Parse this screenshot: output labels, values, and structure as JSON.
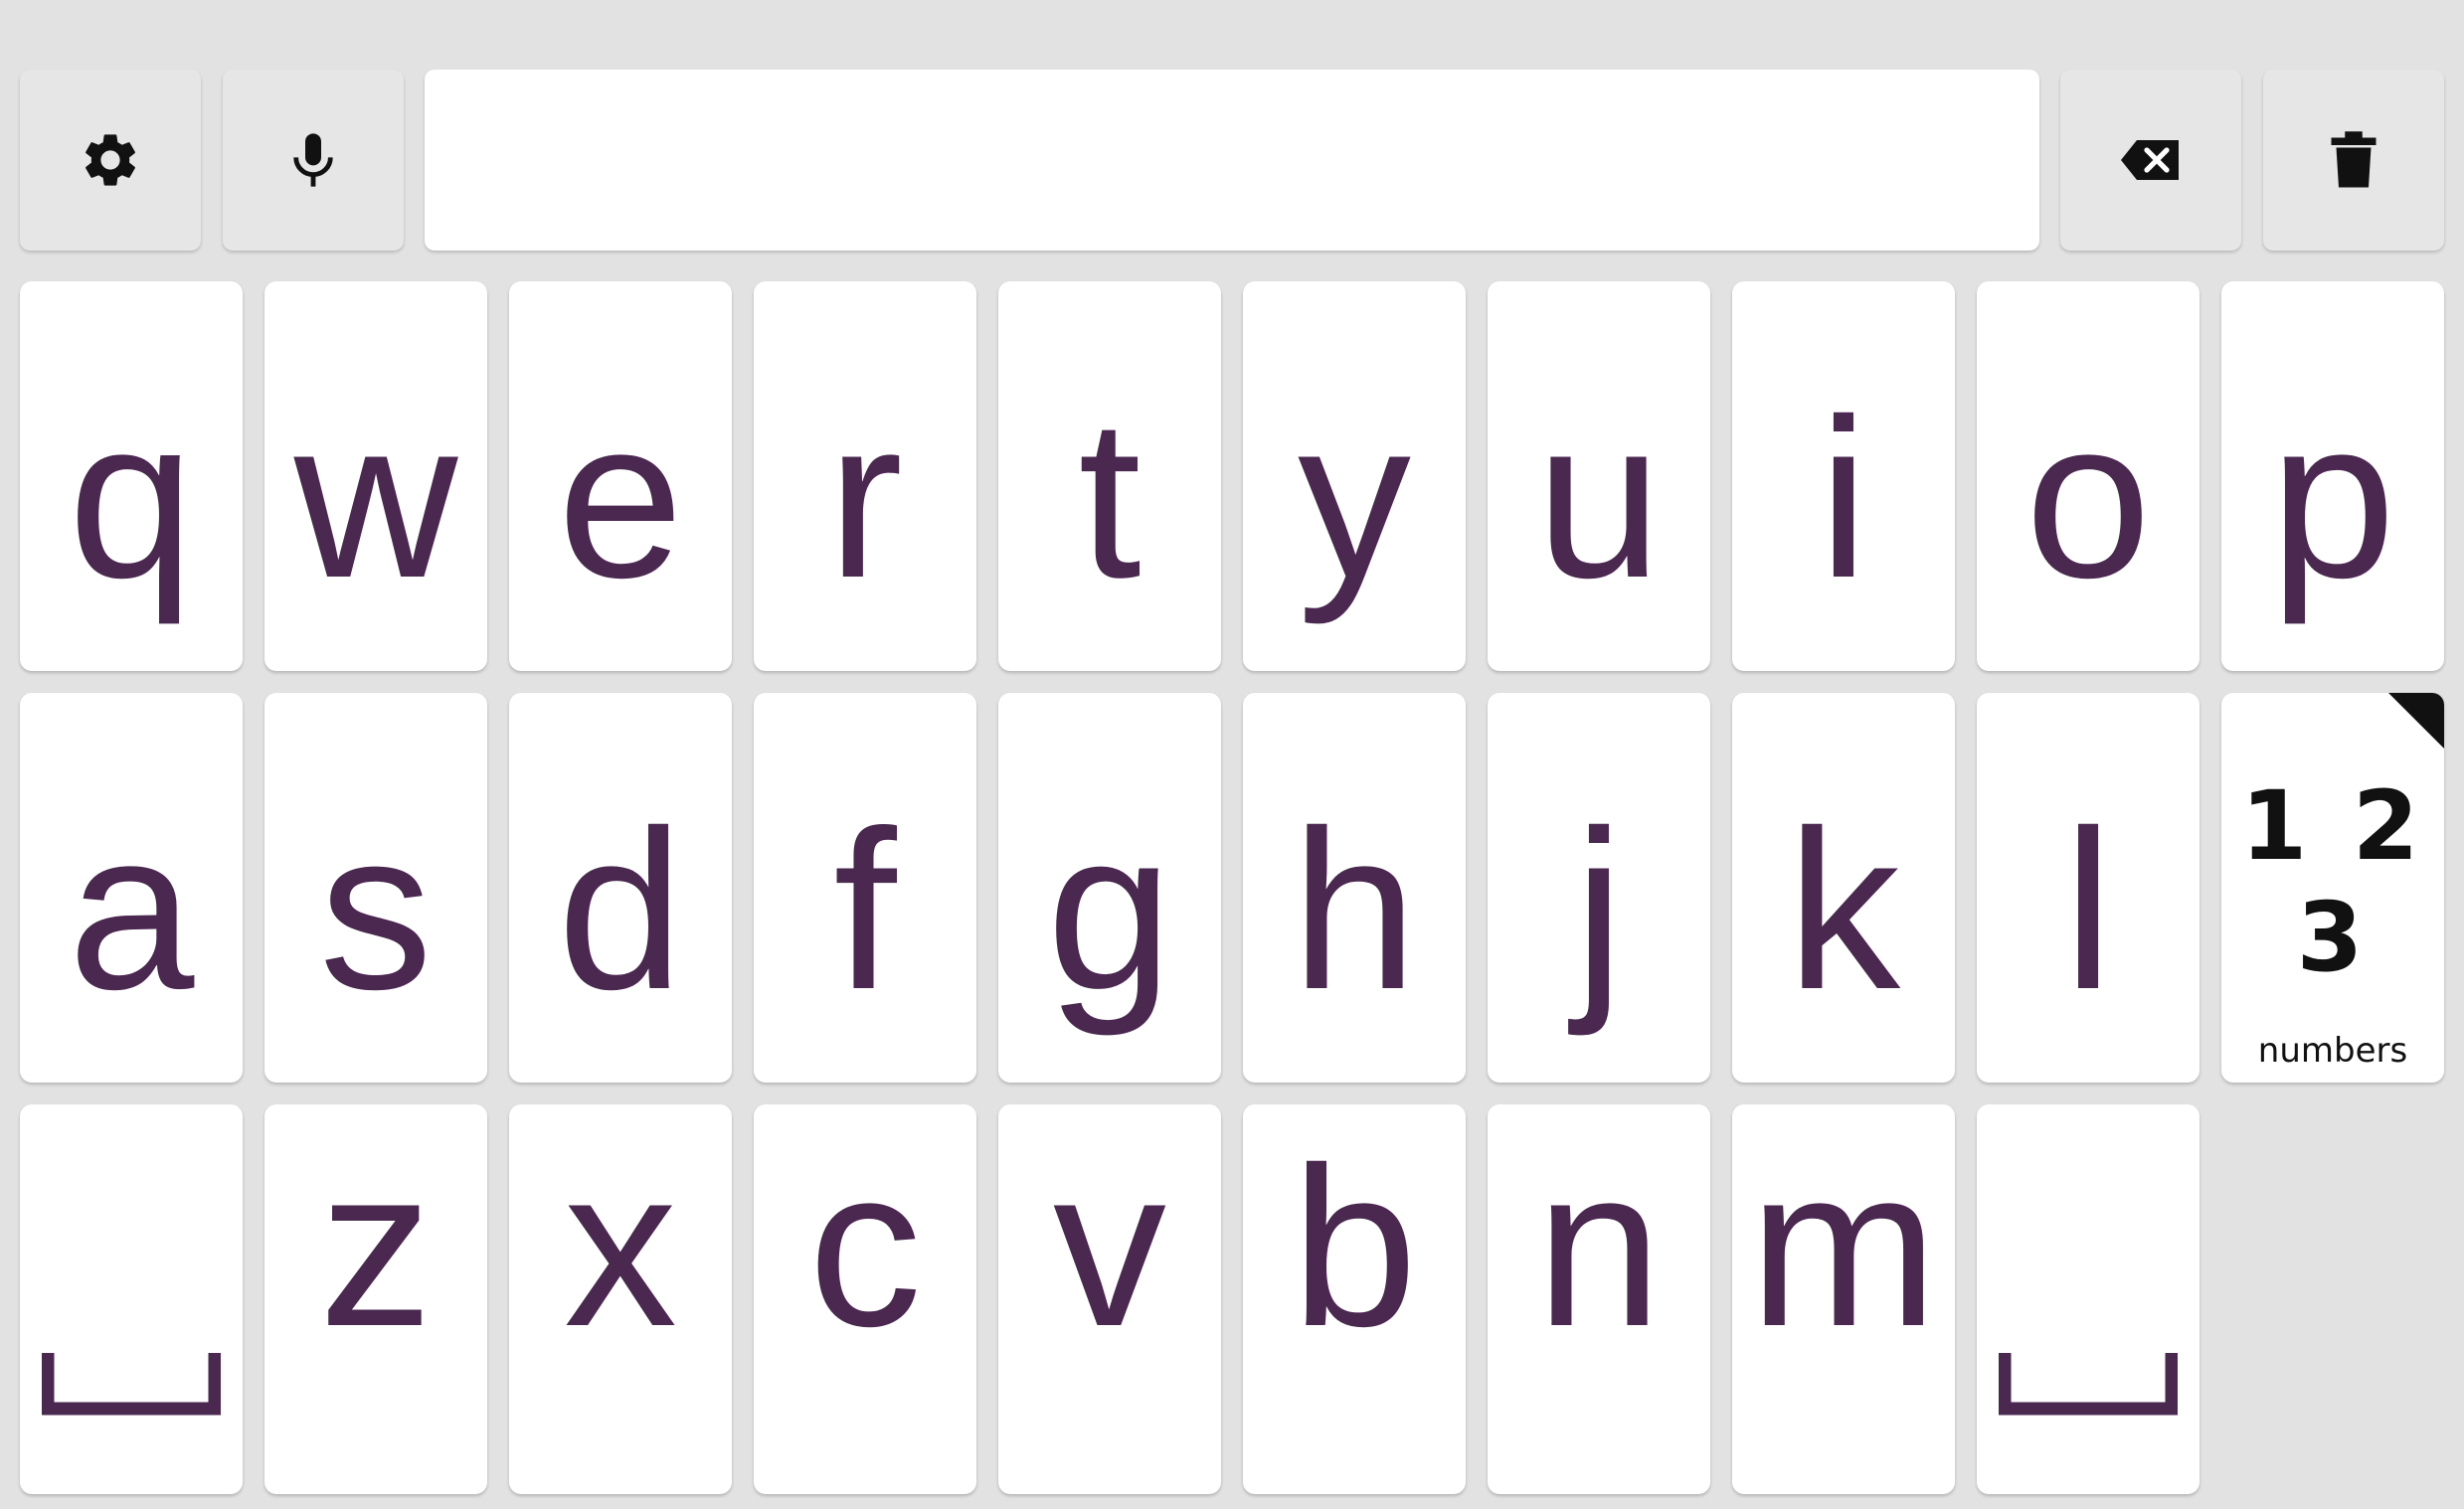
{
  "toolbar": {
    "settings_icon": "gear-icon",
    "mic_icon": "microphone-icon",
    "backspace_icon": "backspace-icon",
    "clear_icon": "trash-icon"
  },
  "text_display": {
    "value": ""
  },
  "keys": {
    "row1": [
      "q",
      "w",
      "e",
      "r",
      "t",
      "y",
      "u",
      "i",
      "o",
      "p"
    ],
    "row2": [
      "a",
      "s",
      "d",
      "f",
      "g",
      "h",
      "j",
      "k",
      "l"
    ],
    "row3": [
      "z",
      "x",
      "c",
      "v",
      "b",
      "n",
      "m"
    ],
    "numbers_glyph": "1 2 3",
    "numbers_label": "numbers",
    "space_icon": "space-icon"
  },
  "colors": {
    "key_text": "#4a2850",
    "background": "#e2e2e2",
    "key_bg": "#ffffff",
    "tool_bg": "#e6e6e6"
  }
}
